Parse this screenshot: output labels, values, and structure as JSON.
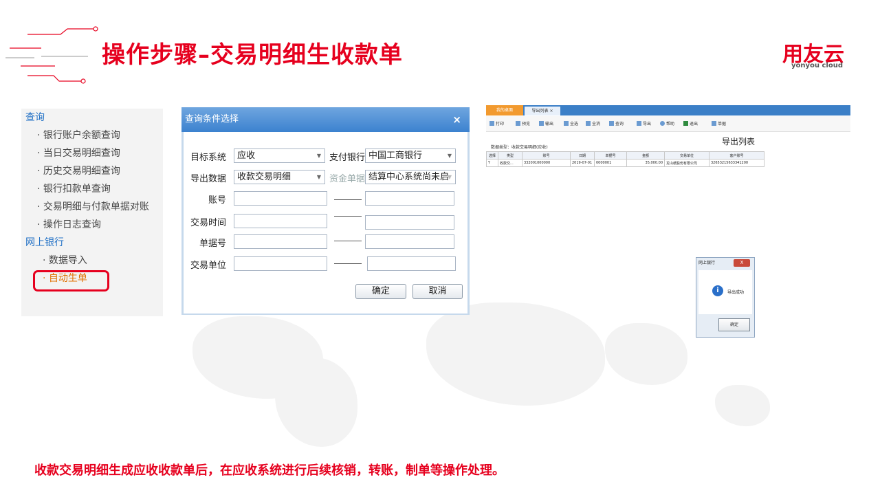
{
  "header": {
    "title": "操作步骤–交易明细生收款单",
    "logo_cn": "用友云",
    "logo_en": "yonyou cloud"
  },
  "menu": {
    "cat_query": "查询",
    "items_query": [
      "银行账户余额查询",
      "当日交易明细查询",
      "历史交易明细查询",
      "银行扣款单查询",
      "交易明细与付款单据对账",
      "操作日志查询"
    ],
    "cat_bank": "网上银行",
    "items_bank": [
      "数据导入",
      "自动生单"
    ]
  },
  "dialog": {
    "title": "查询条件选择",
    "close": "×",
    "target_system_label": "目标系统",
    "target_system_value": "应收",
    "pay_bank_label": "支付银行",
    "pay_bank_value": "中国工商银行",
    "export_data_label": "导出数据",
    "export_data_value": "收款交易明细",
    "fund_doc_label": "资金单据",
    "fund_doc_value": "结算中心系统尚未启",
    "account_label": "账号",
    "trade_time_label": "交易时间",
    "doc_no_label": "单据号",
    "trade_unit_label": "交易单位",
    "ok": "确定",
    "cancel": "取消"
  },
  "right": {
    "tab1": "我的桌面",
    "tab2": "导出列表 ×",
    "toolbar": [
      "打印",
      "预览",
      "输出",
      "全选",
      "全消",
      "查询",
      "导出",
      "帮助",
      "退出",
      "单据"
    ],
    "data_type": "数据类型：收款交易明细(应收)",
    "list_title": "导出列表",
    "columns": [
      "选择",
      "类型",
      "账号",
      "日期",
      "单据号",
      "金额",
      "交易单位",
      "客户账号"
    ],
    "rows": [
      [
        "Y",
        "收款交...",
        "332001000000",
        "2019-07-01",
        "0000001",
        "35,000.00",
        "龙山纸股份有限公司",
        "32653215633341200"
      ]
    ]
  },
  "msgbox": {
    "title": "网上银行",
    "close": "X",
    "text": "导出成功",
    "ok": "确定"
  },
  "footer": {
    "text": "收款交易明细生成应收收款单后，在应收系统进行后续核销，转账，制单等操作处理。"
  }
}
